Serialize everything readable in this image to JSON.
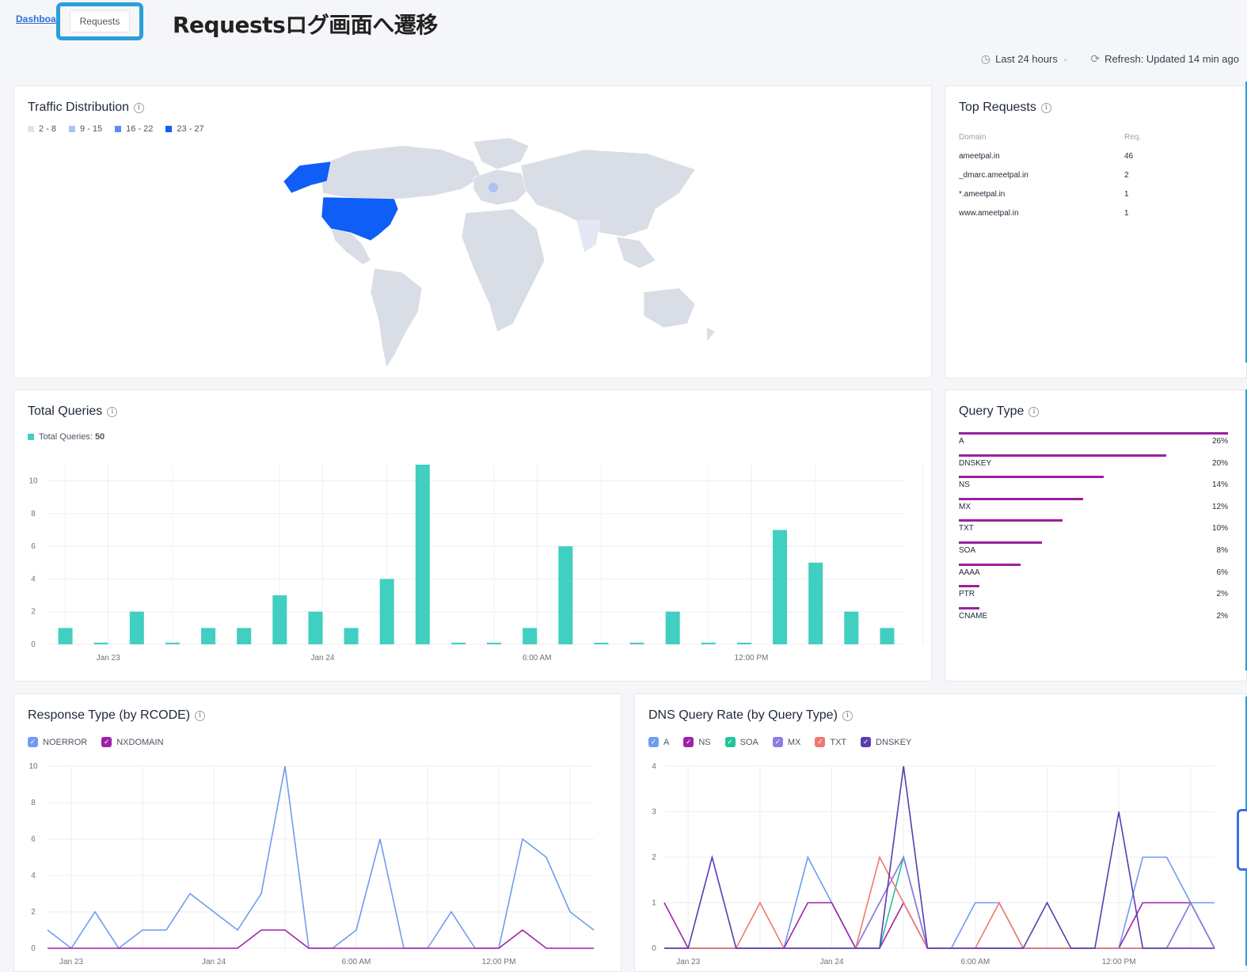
{
  "nav": {
    "tab_dashboard": "Dashboard",
    "tab_requests": "Requests"
  },
  "annotation": "Requestsログ画面へ遷移",
  "toolbar": {
    "time_range": "Last 24 hours",
    "refresh": "Refresh: Updated 14 min ago"
  },
  "traffic": {
    "title": "Traffic Distribution",
    "legend": [
      {
        "label": "2 - 8",
        "color": "#dde4f3"
      },
      {
        "label": "9 - 15",
        "color": "#aac3f3"
      },
      {
        "label": "16 - 22",
        "color": "#5d8ef0"
      },
      {
        "label": "23 - 27",
        "color": "#0f5ef7"
      }
    ]
  },
  "top_requests": {
    "title": "Top Requests",
    "headers": [
      "Domain",
      "Req."
    ],
    "rows": [
      {
        "domain": "ameetpal.in",
        "req": "46"
      },
      {
        "domain": "_dmarc.ameetpal.in",
        "req": "2"
      },
      {
        "domain": "*.ameetpal.in",
        "req": "1"
      },
      {
        "domain": "www.ameetpal.in",
        "req": "1"
      }
    ]
  },
  "total_queries": {
    "title": "Total Queries",
    "legend_label": "Total Queries:",
    "legend_value": "50",
    "color": "#40cfc1",
    "chart_data": {
      "type": "bar",
      "values": [
        1,
        0.1,
        2,
        0.1,
        1,
        1,
        3,
        2,
        1,
        4,
        11,
        0.1,
        0.1,
        1,
        6,
        0.1,
        0.1,
        2,
        0.1,
        0.1,
        7,
        5,
        2,
        1
      ],
      "ylim": [
        0,
        11
      ],
      "yticks": [
        "0",
        "2",
        "4",
        "6",
        "8",
        "10"
      ],
      "xticks": [
        {
          "label": "Jan 23",
          "at": 1.2
        },
        {
          "label": "Jan 24",
          "at": 7.2
        },
        {
          "label": "6:00 AM",
          "at": 13.2
        },
        {
          "label": "12:00 PM",
          "at": 19.2
        }
      ]
    }
  },
  "query_type": {
    "title": "Query Type",
    "color": "#9b1fa1",
    "items": [
      {
        "label": "A",
        "pct": "26%",
        "value": 26
      },
      {
        "label": "DNSKEY",
        "pct": "20%",
        "value": 20
      },
      {
        "label": "NS",
        "pct": "14%",
        "value": 14
      },
      {
        "label": "MX",
        "pct": "12%",
        "value": 12
      },
      {
        "label": "TXT",
        "pct": "10%",
        "value": 10
      },
      {
        "label": "SOA",
        "pct": "8%",
        "value": 8
      },
      {
        "label": "AAAA",
        "pct": "6%",
        "value": 6
      },
      {
        "label": "PTR",
        "pct": "2%",
        "value": 2
      },
      {
        "label": "CNAME",
        "pct": "2%",
        "value": 2
      }
    ]
  },
  "response_type": {
    "title": "Response Type (by RCODE)",
    "legend": [
      {
        "label": "NOERROR",
        "color": "#6e9cf0"
      },
      {
        "label": "NXDOMAIN",
        "color": "#a020a8"
      }
    ],
    "chart_data": {
      "type": "line",
      "ylim": [
        0,
        10
      ],
      "yticks": [
        "0",
        "2",
        "4",
        "6",
        "8",
        "10"
      ],
      "xticks": [
        {
          "label": "Jan 23",
          "at": 1
        },
        {
          "label": "Jan 24",
          "at": 7
        },
        {
          "label": "6:00 AM",
          "at": 13
        },
        {
          "label": "12:00 PM",
          "at": 19
        }
      ],
      "series": [
        {
          "name": "NOERROR",
          "color": "#6e9cf0",
          "values": [
            1,
            0,
            2,
            0,
            1,
            1,
            3,
            2,
            1,
            3,
            10,
            0,
            0,
            1,
            6,
            0,
            0,
            2,
            0,
            0,
            6,
            5,
            2,
            1
          ]
        },
        {
          "name": "NXDOMAIN",
          "color": "#a020a8",
          "values": [
            0,
            0,
            0,
            0,
            0,
            0,
            0,
            0,
            0,
            1,
            1,
            0,
            0,
            0,
            0,
            0,
            0,
            0,
            0,
            0,
            1,
            0,
            0,
            0
          ]
        }
      ]
    }
  },
  "dns_rate": {
    "title": "DNS Query Rate (by Query Type)",
    "legend": [
      {
        "label": "A",
        "color": "#6e9cf0"
      },
      {
        "label": "NS",
        "color": "#a020a8"
      },
      {
        "label": "SOA",
        "color": "#22c39a"
      },
      {
        "label": "MX",
        "color": "#8e7ce0"
      },
      {
        "label": "TXT",
        "color": "#f0786e"
      },
      {
        "label": "DNSKEY",
        "color": "#5a3bb0"
      }
    ],
    "chart_data": {
      "type": "line",
      "ylim": [
        0,
        4
      ],
      "yticks": [
        "0",
        "1",
        "2",
        "3",
        "4"
      ],
      "xticks": [
        {
          "label": "Jan 23",
          "at": 1
        },
        {
          "label": "Jan 24",
          "at": 7
        },
        {
          "label": "6:00 AM",
          "at": 13
        },
        {
          "label": "12:00 PM",
          "at": 19
        }
      ],
      "series": [
        {
          "name": "A",
          "color": "#6e9cf0",
          "values": [
            0,
            0,
            0,
            0,
            0,
            0,
            2,
            1,
            0,
            1,
            2,
            0,
            0,
            1,
            1,
            0,
            0,
            0,
            0,
            0,
            2,
            2,
            1,
            1
          ]
        },
        {
          "name": "NS",
          "color": "#a020a8",
          "values": [
            1,
            0,
            0,
            0,
            0,
            0,
            1,
            1,
            0,
            0,
            1,
            0,
            0,
            0,
            0,
            0,
            0,
            0,
            0,
            0,
            1,
            1,
            1,
            0
          ]
        },
        {
          "name": "SOA",
          "color": "#22c39a",
          "values": [
            0,
            0,
            0,
            0,
            0,
            0,
            0,
            0,
            0,
            0,
            2,
            0,
            0,
            0,
            0,
            0,
            0,
            0,
            0,
            0,
            0,
            0,
            1,
            0
          ]
        },
        {
          "name": "MX",
          "color": "#8e7ce0",
          "values": [
            0,
            0,
            0,
            0,
            0,
            0,
            0,
            0,
            0,
            1,
            2,
            0,
            0,
            0,
            0,
            0,
            0,
            0,
            0,
            0,
            0,
            0,
            1,
            0
          ]
        },
        {
          "name": "TXT",
          "color": "#f0786e",
          "values": [
            0,
            0,
            0,
            0,
            1,
            0,
            0,
            0,
            0,
            2,
            1,
            0,
            0,
            0,
            1,
            0,
            0,
            0,
            0,
            0,
            0,
            0,
            0,
            0
          ]
        },
        {
          "name": "DNSKEY",
          "color": "#5a3bb0",
          "values": [
            0,
            0,
            2,
            0,
            0,
            0,
            0,
            0,
            0,
            0,
            4,
            0,
            0,
            0,
            0,
            0,
            1,
            0,
            0,
            3,
            0,
            0,
            0,
            0
          ]
        }
      ]
    }
  }
}
